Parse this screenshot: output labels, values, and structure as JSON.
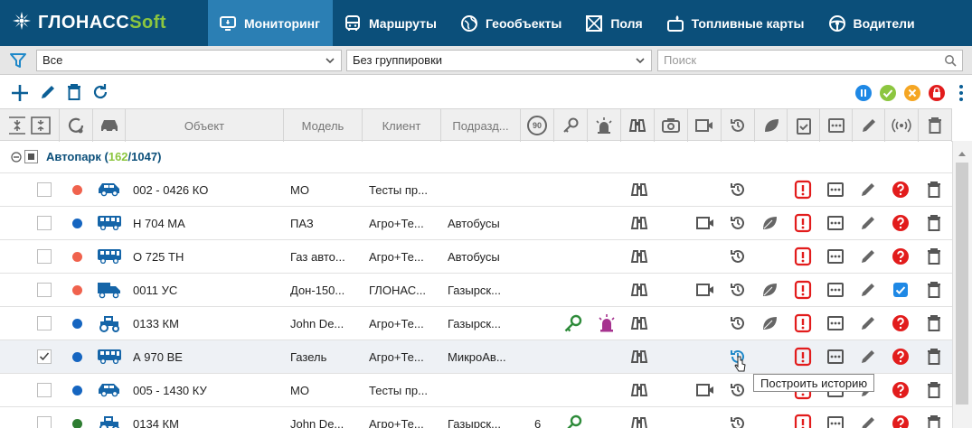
{
  "nav": {
    "logo_main": "ГЛОНАСС",
    "logo_accent": "Soft",
    "items": [
      {
        "label": "Мониторинг",
        "icon": "monitor-icon"
      },
      {
        "label": "Маршруты",
        "icon": "bus-icon"
      },
      {
        "label": "Геообъекты",
        "icon": "globe-icon"
      },
      {
        "label": "Поля",
        "icon": "field-icon"
      },
      {
        "label": "Топливные карты",
        "icon": "fuel-card-icon"
      },
      {
        "label": "Водители",
        "icon": "steering-wheel-icon"
      }
    ]
  },
  "filter": {
    "select1": "Все",
    "select2": "Без группировки",
    "search_placeholder": "Поиск"
  },
  "table": {
    "headers": {
      "object": "Объект",
      "model": "Модель",
      "client": "Клиент",
      "division": "Подразд..."
    },
    "speed_icon_text": "90",
    "group": {
      "name": "Автопарк",
      "open": "(",
      "active": "162",
      "sep": "/",
      "total": "1047",
      "close": ")"
    },
    "rows": [
      {
        "checked": false,
        "status": "#f0624d",
        "vehicle": "car",
        "object": "002 - 0426 КО",
        "model": "МО",
        "client": "Тесты пр...",
        "division": "",
        "speed": "",
        "key": false,
        "alarm": false,
        "camera": false,
        "leaf": false,
        "task": "none",
        "history_cursor": false
      },
      {
        "checked": false,
        "status": "#1565c0",
        "vehicle": "bus",
        "object": "Н 704 МА",
        "model": "ПАЗ",
        "client": "Агро+Те...",
        "division": "Автобусы",
        "speed": "",
        "key": false,
        "alarm": false,
        "camera": true,
        "leaf": true,
        "task": "none",
        "history_cursor": false
      },
      {
        "checked": false,
        "status": "#f0624d",
        "vehicle": "bus",
        "object": "О 725 ТН",
        "model": "Газ авто...",
        "client": "Агро+Те...",
        "division": "Автобусы",
        "speed": "",
        "key": false,
        "alarm": false,
        "camera": false,
        "leaf": false,
        "task": "none",
        "history_cursor": false
      },
      {
        "checked": false,
        "status": "#f0624d",
        "vehicle": "truck",
        "object": "0011 УС",
        "model": "Дон-150...",
        "client": "ГЛОНАС...",
        "division": "Газырск...",
        "speed": "",
        "key": false,
        "alarm": false,
        "camera": true,
        "leaf": true,
        "task": "check",
        "history_cursor": false
      },
      {
        "checked": false,
        "status": "#1565c0",
        "vehicle": "tractor",
        "object": "0133 КМ",
        "model": "John De...",
        "client": "Агро+Те...",
        "division": "Газырск...",
        "speed": "",
        "key": true,
        "alarm": true,
        "camera": false,
        "leaf": true,
        "task": "none",
        "history_cursor": false
      },
      {
        "checked": true,
        "status": "#1565c0",
        "vehicle": "bus",
        "object": "А 970 ВЕ",
        "model": "Газель",
        "client": "Агро+Те...",
        "division": "МикроАв...",
        "speed": "",
        "key": false,
        "alarm": false,
        "camera": false,
        "leaf": false,
        "task": "none",
        "history_cursor": true
      },
      {
        "checked": false,
        "status": "#1565c0",
        "vehicle": "car",
        "object": "005 - 1430 КУ",
        "model": "МО",
        "client": "Тесты пр...",
        "division": "",
        "speed": "",
        "key": false,
        "alarm": false,
        "camera": true,
        "leaf": false,
        "task": "none",
        "history_cursor": false
      },
      {
        "checked": false,
        "status": "#2e7d32",
        "vehicle": "tractor",
        "object": "0134 КМ",
        "model": "John De...",
        "client": "Агро+Те...",
        "division": "Газырск...",
        "speed": "6",
        "key": true,
        "alarm": false,
        "camera": false,
        "leaf": false,
        "task": "none",
        "history_cursor": false
      }
    ]
  },
  "tooltip": "Построить историю",
  "colors": {
    "nav_bg": "#0b4f7a",
    "nav_active": "#2b7fb4",
    "accent_green": "#8cc63f",
    "danger_red": "#e21c1c",
    "group_title": "#0b4f7a"
  }
}
